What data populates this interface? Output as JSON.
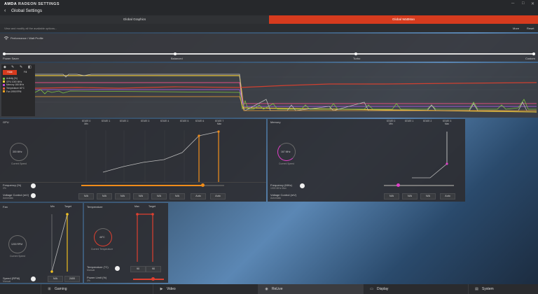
{
  "app": {
    "brand": "AMDA",
    "title_text": "RADEON SETTINGS",
    "page_title": "Global Settings",
    "back_symbol": "‹"
  },
  "window": {
    "controls": [
      "─",
      "□",
      "✕"
    ]
  },
  "tabs": [
    {
      "label": "Global Graphics"
    },
    {
      "label": "Global WattMan"
    }
  ],
  "infobar": {
    "text": "View and modify all the available options...",
    "more": "More",
    "reset": "Reset"
  },
  "profile": {
    "label": "Performance / Watt Profile",
    "icon": "wifi-icon",
    "stops": [
      "Power Saver",
      "Balanced",
      "Turbo",
      "Custom"
    ]
  },
  "history": {
    "tools": [
      "◆",
      "✎",
      "✎",
      "◧"
    ],
    "tabs": [
      "Hide",
      "Fill"
    ],
    "legend": [
      {
        "label": "Activity (%)",
        "color": "#7fc241"
      },
      {
        "label": "GPU 1000 MHz",
        "color": "#ffd23a"
      },
      {
        "label": "Memory 166 MHz",
        "color": "#c04bd6"
      },
      {
        "label": "Temperature 46°C",
        "color": "#e06040"
      },
      {
        "label": "Fan 1995 RPM",
        "color": "#f0a020"
      }
    ],
    "colors": {
      "yellow": "#e8c43a",
      "pink": "#e05080",
      "purple": "#9b58d0",
      "red": "#d04030",
      "green": "#7fc241",
      "orange": "#f0a030",
      "white": "#bbbbbb"
    }
  },
  "gpu": {
    "title": "GPU",
    "gauge_value": "300 MHz",
    "gauge_label": "Current Speed",
    "states": [
      {
        "name": "STATE 0",
        "sub": "Min"
      },
      {
        "name": "STATE 1",
        "sub": ""
      },
      {
        "name": "STATE 2",
        "sub": ""
      },
      {
        "name": "STATE 3",
        "sub": ""
      },
      {
        "name": "STATE 4",
        "sub": ""
      },
      {
        "name": "STATE 5",
        "sub": ""
      },
      {
        "name": "STATE 6",
        "sub": ""
      },
      {
        "name": "STATE 7",
        "sub": "Max"
      }
    ],
    "freq_label": "Frequency (%)",
    "freq_value": "0%",
    "freq_level": 0.85,
    "volt_label": "Voltage Control (mV)",
    "volt_value": "Automatic",
    "volt_buttons": [
      "N/A",
      "N/A",
      "N/A",
      "N/A",
      "N/A",
      "N/A",
      "Auto",
      "Auto"
    ],
    "accent": "#f08c1a"
  },
  "memory": {
    "title": "Memory",
    "gauge_value": "167 MHz",
    "gauge_label": "Current Speed",
    "states": [
      {
        "name": "STATE 0",
        "sub": "Min"
      },
      {
        "name": "STATE 1",
        "sub": ""
      },
      {
        "name": "STATE 2",
        "sub": ""
      },
      {
        "name": "STATE 3",
        "sub": "Max"
      }
    ],
    "freq_label": "Frequency (MHz)",
    "freq_value": "1000 MHz Max",
    "freq_level": 0.0,
    "volt_label": "Voltage Control (mV)",
    "volt_value": "Automatic",
    "volt_buttons": [
      "N/A",
      "N/A",
      "N/A",
      "Auto"
    ],
    "accent": "#e040c8"
  },
  "fan": {
    "title": "Fan",
    "min_label": "Min",
    "target_label": "Target",
    "gauge_value": "1200 RPM",
    "gauge_label": "Current Speed",
    "speed_label": "Speed (RPM)",
    "speed_value": "Manual",
    "buttons": [
      "N/A",
      "2400"
    ],
    "accent": "#f0c020"
  },
  "temperature": {
    "title": "Temperature",
    "max_label": "Max",
    "target_label": "Target",
    "gauge_value": "46°C",
    "gauge_label": "Current Temperature",
    "temp_label": "Temperature (°C)",
    "temp_value": "Manual",
    "power_label": "Power Limit (%)",
    "power_value": "0%",
    "buttons": [
      "90",
      "90"
    ],
    "accent": "#e04030"
  },
  "bottom_tabs": [
    {
      "label": "Gaming",
      "icon": "gamepad-icon",
      "glyph": "⊞"
    },
    {
      "label": "Video",
      "icon": "play-icon",
      "glyph": "▶"
    },
    {
      "label": "ReLive",
      "icon": "relive-icon",
      "glyph": "◉"
    },
    {
      "label": "Display",
      "icon": "display-icon",
      "glyph": "▭"
    },
    {
      "label": "System",
      "icon": "system-icon",
      "glyph": "▤"
    }
  ]
}
